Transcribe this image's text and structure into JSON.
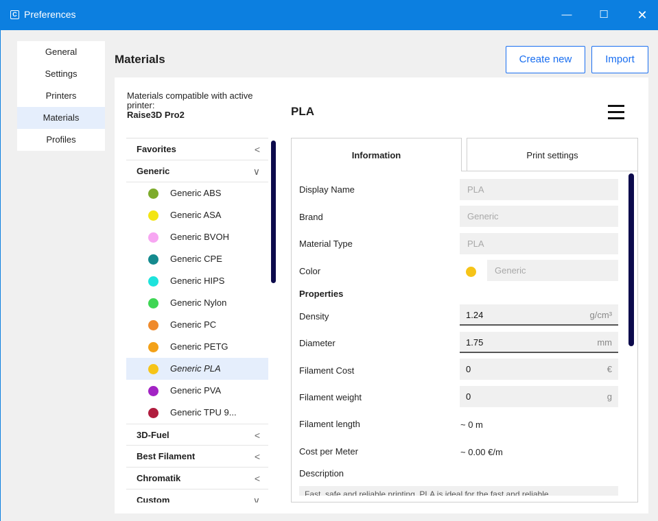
{
  "window": {
    "title": "Preferences",
    "controls": {
      "minimize": "—",
      "maximize": "☐",
      "close": "✕"
    }
  },
  "nav": {
    "items": [
      {
        "label": "General"
      },
      {
        "label": "Settings"
      },
      {
        "label": "Printers"
      },
      {
        "label": "Materials",
        "active": true
      },
      {
        "label": "Profiles"
      }
    ]
  },
  "header": {
    "title": "Materials",
    "create_label": "Create new",
    "import_label": "Import"
  },
  "compat": {
    "text": "Materials compatible with active printer:",
    "printer": "Raise3D Pro2"
  },
  "list": {
    "categories_top": [
      {
        "label": "Favorites",
        "chevron": "<"
      },
      {
        "label": "Generic",
        "chevron": "∨"
      }
    ],
    "materials": [
      {
        "label": "Generic ABS",
        "color": "#7dab2b"
      },
      {
        "label": "Generic ASA",
        "color": "#f3e513"
      },
      {
        "label": "Generic BVOH",
        "color": "#f7a6f2"
      },
      {
        "label": "Generic CPE",
        "color": "#148a8e"
      },
      {
        "label": "Generic HIPS",
        "color": "#1ee3dc"
      },
      {
        "label": "Generic Nylon",
        "color": "#3ed654"
      },
      {
        "label": "Generic PC",
        "color": "#ef8a2c"
      },
      {
        "label": "Generic PETG",
        "color": "#f3a118"
      },
      {
        "label": "Generic PLA",
        "color": "#f6c418",
        "active": true
      },
      {
        "label": "Generic PVA",
        "color": "#a223c4"
      },
      {
        "label": "Generic TPU 9...",
        "color": "#b01c3e"
      }
    ],
    "categories_bottom": [
      {
        "label": "3D-Fuel",
        "chevron": "<"
      },
      {
        "label": "Best Filament",
        "chevron": "<"
      },
      {
        "label": "Chromatik",
        "chevron": "<"
      },
      {
        "label": "Custom",
        "chevron": "∨"
      }
    ]
  },
  "material": {
    "name": "PLA",
    "tabs": {
      "information": "Information",
      "print_settings": "Print settings"
    },
    "fields": {
      "display_name": {
        "label": "Display Name",
        "value": "PLA"
      },
      "brand": {
        "label": "Brand",
        "value": "Generic"
      },
      "material_type": {
        "label": "Material Type",
        "value": "PLA"
      },
      "color": {
        "label": "Color",
        "value": "Generic",
        "swatch": "#f6c418"
      }
    },
    "properties": {
      "heading": "Properties",
      "density": {
        "label": "Density",
        "value": "1.24",
        "unit": "g/cm³"
      },
      "diameter": {
        "label": "Diameter",
        "value": "1.75",
        "unit": "mm"
      },
      "filament_cost": {
        "label": "Filament Cost",
        "value": "0",
        "unit": "€"
      },
      "filament_weight": {
        "label": "Filament weight",
        "value": "0",
        "unit": "g"
      },
      "filament_length": {
        "label": "Filament length",
        "value": "~ 0 m"
      },
      "cost_per_meter": {
        "label": "Cost per Meter",
        "value": "~ 0.00 €/m"
      }
    },
    "description": {
      "label": "Description",
      "value": "Fast, safe and reliable printing. PLA is ideal for the fast and reliable"
    }
  }
}
